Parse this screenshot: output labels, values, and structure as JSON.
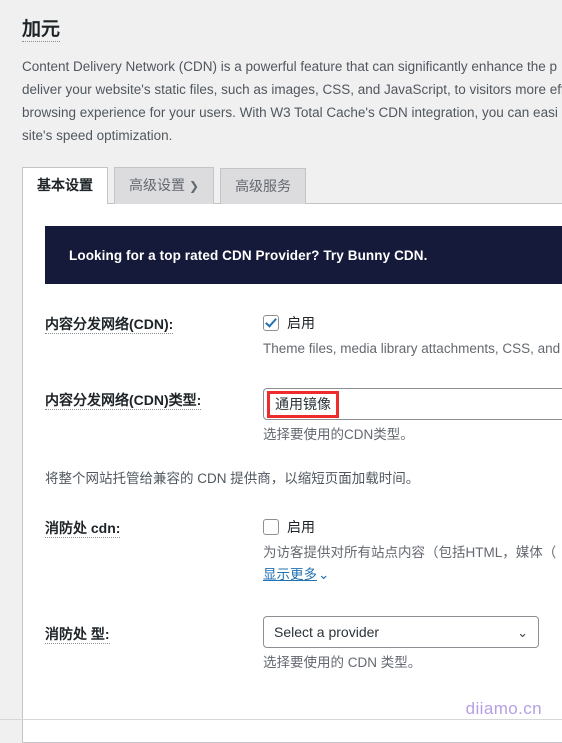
{
  "page": {
    "title": "加元",
    "intro": "Content Delivery Network (CDN) is a powerful feature that can significantly enhance the p\ndeliver your website's static files, such as images, CSS, and JavaScript, to visitors more eff\nbrowsing experience for your users. With W3 Total Cache's CDN integration, you can easi\nsite's speed optimization."
  },
  "tabs": [
    {
      "label": "基本设置",
      "active": true
    },
    {
      "label": "高级设置",
      "chevron": "❯",
      "active": false
    },
    {
      "label": "高级服务",
      "active": false
    }
  ],
  "promo": {
    "text": "Looking for a top rated CDN Provider? Try Bunny CDN."
  },
  "rows": {
    "cdn_enable": {
      "label": "内容分发网络(CDN):",
      "checkbox_label": "启用",
      "checked": true,
      "description": "Theme files, media library attachments, CSS, and"
    },
    "cdn_type": {
      "label": "内容分发网络(CDN)类型:",
      "value": "通用镜像",
      "description": "选择要使用的CDN类型。",
      "annotated": true
    },
    "note": "将整个网站托管给兼容的 CDN 提供商，以缩短页面加载时间。",
    "fsd_cdn": {
      "label": "消防处 cdn:",
      "checkbox_label": "启用",
      "checked": false,
      "description": "为访客提供对所有站点内容（包括HTML，媒体（",
      "show_more": "显示更多",
      "show_more_chevron": "⌄"
    },
    "fsd_type": {
      "label": "消防处 型:",
      "value": "Select a provider",
      "arrow": "⌄",
      "description": "选择要使用的 CDN 类型。"
    }
  },
  "watermark": "diiamo.cn",
  "colors": {
    "accent": "#2271b1",
    "promo_bg": "#15193a",
    "annotation": "#ef2b2b",
    "page_bg": "#f0f0f1"
  }
}
